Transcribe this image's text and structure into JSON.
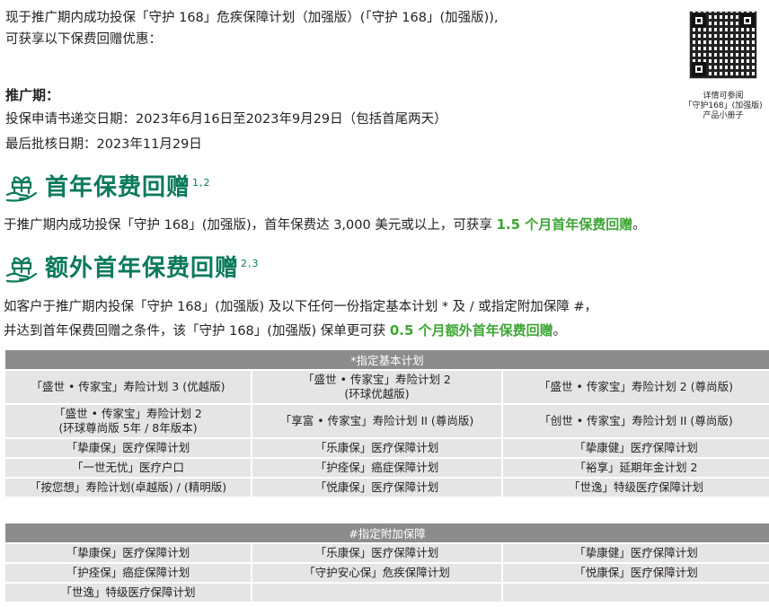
{
  "intro": {
    "line1": "现于推广期内成功投保「守护 168」危疾保障计划（加强版）(「守护 168」(加强版)),",
    "line2": "可获享以下保费回赠优惠："
  },
  "promo": {
    "title": "推广期：",
    "application_period": "投保申请书递交日期：2023年6月16日至2023年9月29日（包括首尾两天）",
    "approval_deadline": "最后批核日期：2023年11月29日"
  },
  "qr": {
    "caption_line1": "详情可参阅",
    "caption_line2": "「守护168」(加强版)",
    "caption_line3": "产品小册子"
  },
  "section1": {
    "title": "首年保费回赠",
    "superscript": "1,2",
    "text": "于推广期内成功投保「守护 168」(加强版)，首年保费达 3,000 美元或以上，可获享 ",
    "highlight": "1.5 个月首年保费回赠",
    "end": "。"
  },
  "section2": {
    "title": "额外首年保费回赠",
    "superscript": "2,3",
    "line1": "如客户于推广期内投保「守护 168」(加强版) 及以下任何一份指定基本计划 * 及 / 或指定附加保障 #，",
    "line2_pre": "并达到首年保费回赠之条件，该「守护 168」(加强版) 保单更可获 ",
    "highlight": "0.5 个月额外首年保费回赠",
    "end": "。"
  },
  "basic_plans": {
    "header": "*指定基本计划",
    "rows": [
      [
        "「盛世 • 传家宝」寿险计划 3 (优越版)",
        "「盛世 • 传家宝」寿险计划 2\n(环球优越版)",
        "「盛世 • 传家宝」寿险计划 2 (尊尚版)"
      ],
      [
        "「盛世 • 传家宝」寿险计划 2\n(环球尊尚版 5年 / 8年版本)",
        "「享富 • 传家宝」寿险计划 II (尊尚版)",
        "「创世 • 传家宝」寿险计划 II (尊尚版)"
      ],
      [
        "「挚康保」医疗保障计划",
        "「乐康保」医疗保障计划",
        "「挚康健」医疗保障计划"
      ],
      [
        "「一世无忧」医疗户口",
        "「护痊保」癌症保障计划",
        "「裕享」延期年金计划 2"
      ],
      [
        "「按您想」寿险计划(卓越版) / (精明版)",
        "「悦康保」医疗保障计划",
        "「世逸」特级医疗保障计划"
      ]
    ]
  },
  "riders": {
    "header": "#指定附加保障",
    "rows": [
      [
        "「挚康保」医疗保障计划",
        "「乐康保」医疗保障计划",
        "「挚康健」医疗保障计划"
      ],
      [
        "「护痊保」癌症保障计划",
        "「守护安心保」危疾保障计划",
        "「悦康保」医疗保障计划"
      ],
      [
        "「世逸」特级医疗保障计划",
        "",
        ""
      ]
    ]
  },
  "colors": {
    "accent_green": "#0a7a5a",
    "highlight_green": "#3fa535",
    "table_header": "#8c8c8c",
    "table_cell": "#e5e5e5"
  }
}
